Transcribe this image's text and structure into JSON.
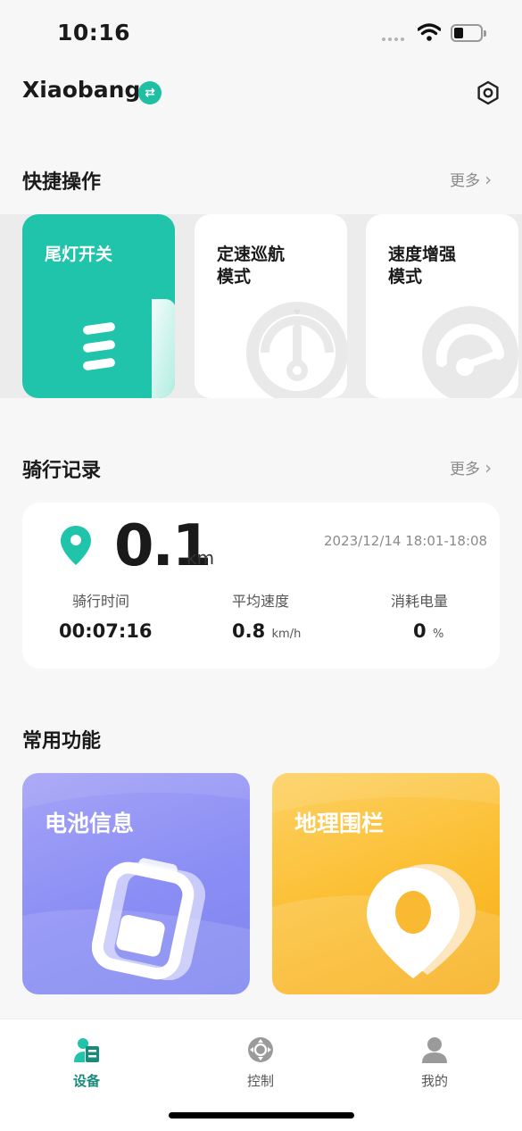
{
  "status_bar": {
    "time": "10:16"
  },
  "header": {
    "device_name": "Xiaobang"
  },
  "quick_actions": {
    "title": "快捷操作",
    "more": "更多",
    "cards": [
      {
        "label_line1": "尾灯开关",
        "label_line2": "",
        "active": true,
        "icon": "tail-light-icon"
      },
      {
        "label_line1": "定速巡航",
        "label_line2": "模式",
        "active": false,
        "icon": "speedometer-icon"
      },
      {
        "label_line1": "速度增强",
        "label_line2": "模式",
        "active": false,
        "icon": "speed-boost-icon"
      }
    ]
  },
  "ride_record": {
    "title": "骑行记录",
    "more": "更多",
    "distance": "0.1",
    "distance_unit": "km",
    "date": "2023/12/14 18:01-18:08",
    "stats": [
      {
        "label": "骑行时间",
        "value": "00:07:16",
        "unit": ""
      },
      {
        "label": "平均速度",
        "value": "0.8",
        "unit": "km/h"
      },
      {
        "label": "消耗电量",
        "value": "0",
        "unit": "%"
      }
    ]
  },
  "functions": {
    "title": "常用功能",
    "cards": [
      {
        "label": "电池信息",
        "icon": "battery-icon",
        "color": "#8a8df4"
      },
      {
        "label": "地理围栏",
        "icon": "geofence-pin-icon",
        "color": "#fbbd2e"
      }
    ]
  },
  "tabs": [
    {
      "label": "设备",
      "icon": "device-icon",
      "active": true
    },
    {
      "label": "控制",
      "icon": "control-icon",
      "active": false
    },
    {
      "label": "我的",
      "icon": "profile-icon",
      "active": false
    }
  ],
  "colors": {
    "accent": "#1fc4aa",
    "tab_active": "#1a8a7a"
  }
}
